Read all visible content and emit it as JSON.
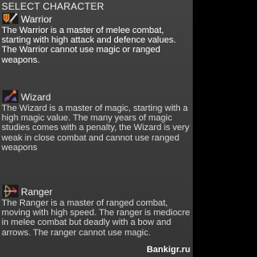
{
  "screen": {
    "title": "SELECT CHARACTER"
  },
  "characters": [
    {
      "id": "warrior",
      "name": "Warrior",
      "icon": "warrior-sword-shield-icon",
      "selected": true,
      "description": "The Warrior is a master of melee combat, starting with high attack and defence values. The Warrior cannot use magic or ranged weapons."
    },
    {
      "id": "wizard",
      "name": "Wizard",
      "icon": "wizard-staff-icon",
      "selected": false,
      "description": "The Wizard is a master of magic, starting with a high magic value. The many years of magic studies comes with a penalty, the Wizard is very weak in close combat and cannot use ranged weapons"
    },
    {
      "id": "ranger",
      "name": "Ranger",
      "icon": "ranger-bow-icon",
      "selected": false,
      "description": "The Ranger is a master of ranged combat, moving with high speed. The ranger is mediocre in melee combat but deadly with a bow and arrows. The ranger cannot use magic."
    }
  ],
  "watermark": "Bankigr.ru",
  "colors": {
    "background": "#3b3b3b",
    "text": "#e8e8e8"
  }
}
